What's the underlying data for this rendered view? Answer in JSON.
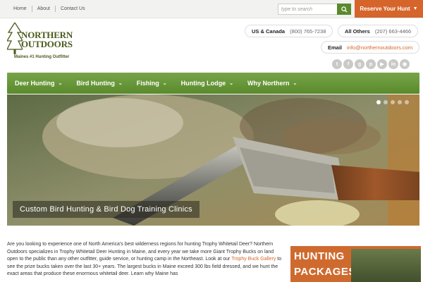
{
  "topbar": {
    "links": [
      "Home",
      "About",
      "Contact Us"
    ],
    "search_placeholder": "type to search",
    "reserve_label": "Reserve Your Hunt"
  },
  "logo": {
    "line1": "NORTHERN",
    "line2": "OUTDOORS",
    "tagline": "Maines #1 Hunting Outfitter"
  },
  "contacts": {
    "us_canada_label": "US & Canada",
    "us_canada_phone": "(800) 765-7238",
    "all_others_label": "All Others",
    "all_others_phone": "(207) 663-4466",
    "email_label": "Email",
    "email_value": "info@northernoutdoors.com"
  },
  "social_icons": [
    "twitter-icon",
    "facebook-icon",
    "google-plus-icon",
    "pinterest-icon",
    "youtube-icon",
    "linkedin-icon",
    "camera-icon"
  ],
  "nav": {
    "items": [
      "Deer Hunting",
      "Bird Hunting",
      "Fishing",
      "Hunting Lodge",
      "Why Northern"
    ]
  },
  "hero": {
    "caption": "Custom Bird Hunting & Bird Dog Training Clinics",
    "slide_count": 5,
    "active_slide": 1
  },
  "intro": {
    "p1": "Are you looking to experience one of North America's best wilderness regions for hunting Trophy Whitetail Deer? Northern Outdoors specializes in Trophy Whitetail Deer Hunting in Maine, and every year we take more Giant Trophy Bucks on land open to the public than any other outfitter, guide service, or hunting camp in the Northeast. Look at our ",
    "link": "Trophy Buck Gallery",
    "p2": " to see the prize bucks taken over the last 30+ years. The largest bucks in Maine exceed 300 lbs field dressed, and we hunt the exact areas that produce these enormous whitetail deer. Learn why Maine has"
  },
  "banner": {
    "line1": "HUNTING",
    "line2": "PACKAGES"
  },
  "colors": {
    "accent_orange": "#d5652b",
    "nav_green": "#5a8a2c",
    "logo_green": "#4b5a1e"
  }
}
